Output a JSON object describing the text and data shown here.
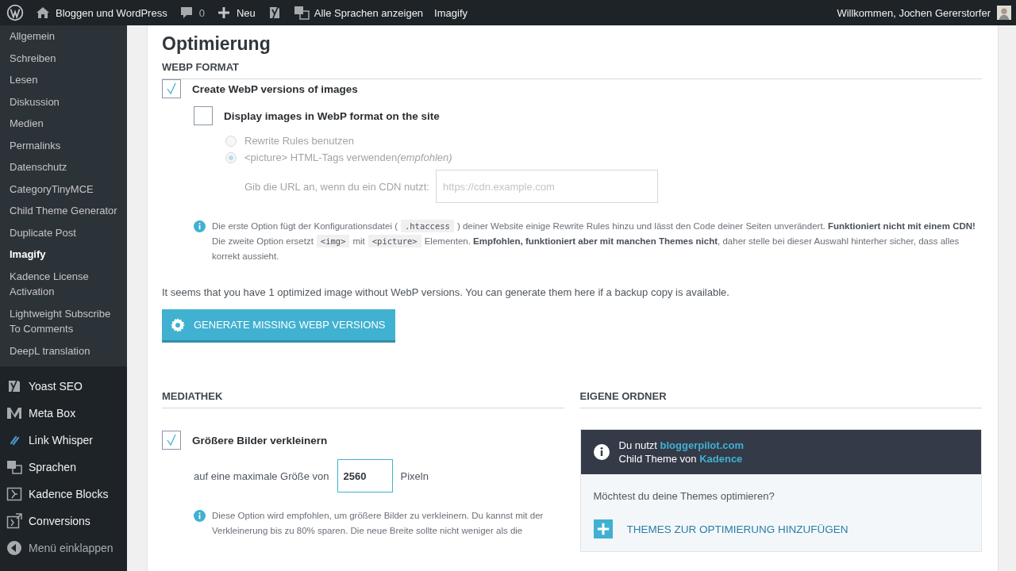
{
  "admin_bar": {
    "site": "Bloggen und WordPress",
    "comments": "0",
    "new": "Neu",
    "languages": "Alle Sprachen anzeigen",
    "plugin": "Imagify",
    "greeting": "Willkommen, Jochen Gererstorfer"
  },
  "sidebar": {
    "submenu": [
      {
        "label": "Allgemein",
        "selected": false
      },
      {
        "label": "Schreiben",
        "selected": false
      },
      {
        "label": "Lesen",
        "selected": false
      },
      {
        "label": "Diskussion",
        "selected": false
      },
      {
        "label": "Medien",
        "selected": false
      },
      {
        "label": "Permalinks",
        "selected": false
      },
      {
        "label": "Datenschutz",
        "selected": false
      },
      {
        "label": "CategoryTinyMCE",
        "selected": false
      },
      {
        "label": "Child Theme Generator",
        "selected": false
      },
      {
        "label": "Duplicate Post",
        "selected": false
      },
      {
        "label": "Imagify",
        "selected": true
      },
      {
        "label": "Kadence License Activation",
        "selected": false
      },
      {
        "label": "Lightweight Subscribe To Comments",
        "selected": false
      },
      {
        "label": "DeepL translation",
        "selected": false
      }
    ],
    "menu": [
      {
        "label": "Yoast SEO",
        "kind": "yoast"
      },
      {
        "label": "Meta Box",
        "kind": "metabox"
      },
      {
        "label": "Link Whisper",
        "kind": "link"
      },
      {
        "label": "Sprachen",
        "kind": "translate"
      },
      {
        "label": "Kadence Blocks",
        "kind": "kadence"
      },
      {
        "label": "Conversions",
        "kind": "conversions"
      },
      {
        "label": "Menü einklappen",
        "kind": "collapse"
      }
    ]
  },
  "page": {
    "title": "Optimierung",
    "webp": {
      "heading": "WEBP FORMAT",
      "create": {
        "label": "Create WebP versions of images",
        "checked": true
      },
      "display": {
        "label": "Display images in WebP format on the site",
        "checked": false
      },
      "radios": [
        {
          "label": "Rewrite Rules benutzen",
          "selected": false,
          "disabled": true
        },
        {
          "label": "<picture> HTML-Tags verwenden",
          "note": "(empfohlen)",
          "selected": true,
          "disabled": true
        }
      ],
      "cdn": {
        "label": "Gib die URL an, wenn du ein CDN nutzt:",
        "placeholder": "https://cdn.example.com"
      },
      "note": [
        [
          {
            "kind": "text",
            "text": "Die erste Option fügt der Konfigurationsdatei ("
          },
          {
            "kind": "code",
            "text": ".htaccess"
          },
          {
            "kind": "text",
            "text": ") deiner Website einige Rewrite Rules hinzu und lässt den Code deiner Seiten unverändert. **Funktioniert nicht mit einem CDN!**"
          }
        ],
        [
          {
            "kind": "text",
            "text": "Die zweite Option ersetzt"
          },
          {
            "kind": "code",
            "text": "<img>"
          },
          {
            "kind": "text",
            "text": "mit"
          },
          {
            "kind": "code",
            "text": "<picture>"
          },
          {
            "kind": "text",
            "text": "Elementen. **Empfohlen, funktioniert aber mit manchen Themes nicht**, daher stelle bei dieser Auswahl hinterher sicher, dass alles korrekt aussieht."
          }
        ]
      ],
      "message": "It seems that you have 1 optimized image without WebP versions. You can generate them here if a backup copy is available.",
      "button": "GENERATE MISSING WEBP VERSIONS"
    },
    "mediathek": {
      "heading": "MEDIATHEK",
      "resize": {
        "label": "Größere Bilder verkleinern",
        "checked": true
      },
      "size": {
        "before": "auf eine maximale Größe von",
        "value": "2560",
        "after": "Pixeln"
      },
      "note": "Diese Option wird empfohlen, um größere Bilder zu verkleinern. Du kannst mit der Verkleinerung bis zu 80% sparen. Die neue Breite sollte nicht weniger als die"
    },
    "folders": {
      "heading": "EIGENE ORDNER",
      "theme_line1": "Du nutzt",
      "theme_name": "bloggerpilot.com",
      "theme_line2": "Child Theme von",
      "parent_name": "Kadence",
      "question": "Möchtest du deine Themes optimieren?",
      "add": "THEMES ZUR OPTIMIERUNG HINZUFÜGEN"
    }
  }
}
